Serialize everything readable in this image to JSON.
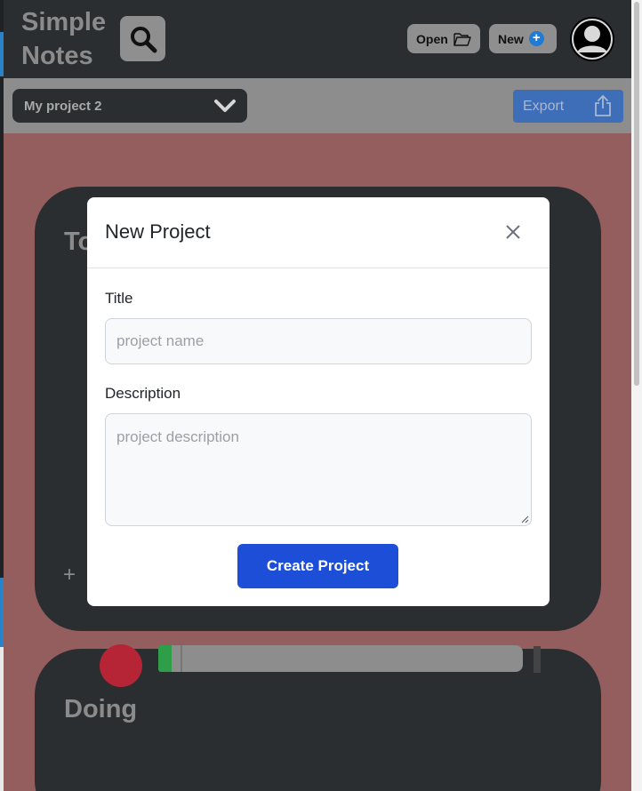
{
  "app": {
    "logo_line1": "Simple",
    "logo_line2": "Notes"
  },
  "header": {
    "open_label": "Open",
    "new_label": "New",
    "new_icon": "plus-circle-icon",
    "search_icon": "search-icon",
    "avatar_icon": "user-avatar-icon"
  },
  "project_bar": {
    "selected_project": "My project 2",
    "export_label": "Export"
  },
  "board": {
    "columns": [
      {
        "title": "To"
      },
      {
        "title": "Doing"
      }
    ],
    "add_card_label": "+"
  },
  "modal": {
    "title": "New Project",
    "title_label": "Title",
    "title_placeholder": "project name",
    "description_label": "Description",
    "description_placeholder": "project description",
    "submit_label": "Create Project"
  },
  "colors": {
    "header_bg": "#2b2e31",
    "board_bg": "#945e5e",
    "primary_button": "#1d4ed8",
    "export_button": "#3d6eb7"
  }
}
